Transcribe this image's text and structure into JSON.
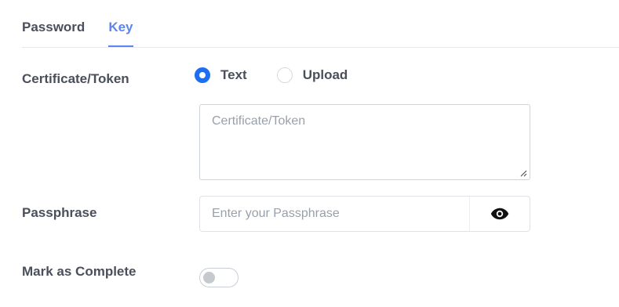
{
  "tabs": [
    {
      "label": "Password",
      "active": false
    },
    {
      "label": "Key",
      "active": true
    }
  ],
  "certificate": {
    "label": "Certificate/Token",
    "options": [
      {
        "label": "Text",
        "selected": true
      },
      {
        "label": "Upload",
        "selected": false
      }
    ],
    "textarea": {
      "value": "",
      "placeholder": "Certificate/Token"
    }
  },
  "passphrase": {
    "label": "Passphrase",
    "value": "",
    "placeholder": "Enter your Passphrase",
    "toggle_icon": "eye-icon"
  },
  "complete": {
    "label": "Mark as Complete",
    "on": false
  },
  "colors": {
    "accent": "#5b86f0",
    "radio_selected": "#1e6ff0",
    "label": "#4a4f5c",
    "placeholder": "#9aa0aa"
  }
}
